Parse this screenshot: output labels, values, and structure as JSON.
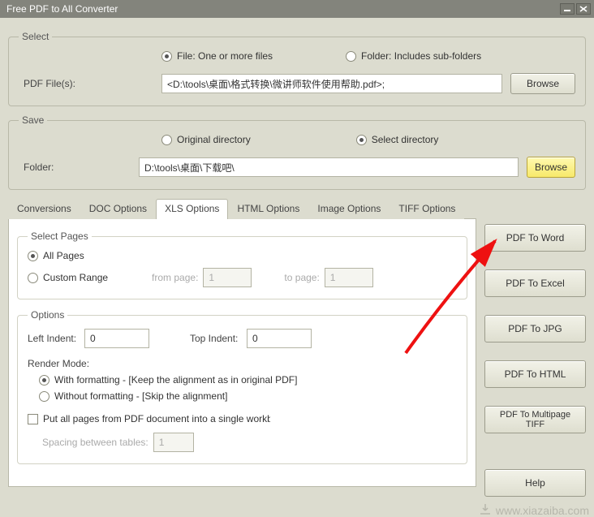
{
  "window": {
    "title": "Free PDF to All Converter"
  },
  "select": {
    "legend": "Select",
    "file_radio": "File:  One or more files",
    "folder_radio": "Folder: Includes sub-folders",
    "pdf_files_label": "PDF File(s):",
    "pdf_files_value": "<D:\\tools\\桌面\\格式转换\\微讲师软件使用帮助.pdf>;",
    "browse": "Browse"
  },
  "save": {
    "legend": "Save",
    "original_radio": "Original directory",
    "select_radio": "Select directory",
    "folder_label": "Folder:",
    "folder_value": "D:\\tools\\桌面\\下载吧\\",
    "browse": "Browse"
  },
  "tabs": {
    "items": [
      "Conversions",
      "DOC Options",
      "XLS Options",
      "HTML Options",
      "Image Options",
      "TIFF Options"
    ],
    "active_index": 2
  },
  "xls": {
    "select_pages": {
      "legend": "Select Pages",
      "all": "All Pages",
      "custom": "Custom Range",
      "from_label": "from page:",
      "from_value": "1",
      "to_label": "to page:",
      "to_value": "1"
    },
    "options": {
      "legend": "Options",
      "left_indent_label": "Left Indent:",
      "left_indent_value": "0",
      "top_indent_label": "Top Indent:",
      "top_indent_value": "0",
      "render_mode_label": "Render Mode:",
      "with_fmt": "With formatting - [Keep the alignment as in original PDF]",
      "without_fmt": "Without formatting - [Skip the alignment]",
      "single_wb": "Put all pages from PDF document into a single workbook",
      "spacing_label": "Spacing between tables:",
      "spacing_value": "1"
    }
  },
  "right": {
    "word": "PDF To Word",
    "excel": "PDF To Excel",
    "jpg": "PDF To JPG",
    "html": "PDF To HTML",
    "tiff": "PDF To Multipage TIFF",
    "help": "Help"
  },
  "watermark": "www.xiazaiba.com"
}
